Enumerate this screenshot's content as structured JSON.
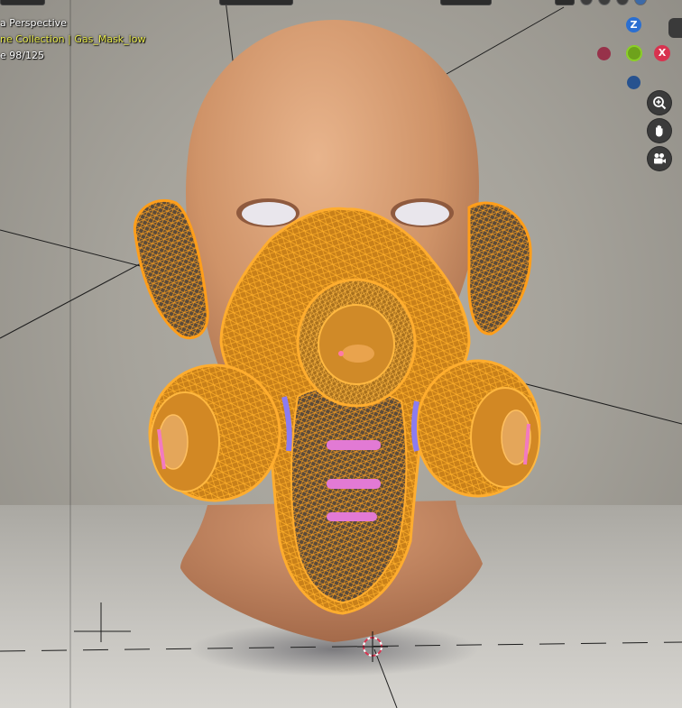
{
  "viewport": {
    "view_name": "a Perspective",
    "collection_path": "ne Collection | Gas_Mask_low",
    "frame_info": "e 98/125"
  },
  "navigation_gizmo": {
    "z_label": "Z",
    "y_label": "",
    "x_label": "X",
    "colors": {
      "x": "#d8334f",
      "y": "#6ea21c",
      "z": "#2b6fd1"
    }
  },
  "navigation_buttons": [
    {
      "name": "zoom",
      "icon": "zoom-in-icon"
    },
    {
      "name": "pan",
      "icon": "hand-icon"
    },
    {
      "name": "camera",
      "icon": "camera-icon"
    }
  ],
  "colors": {
    "wireframe": "#ff9e1a",
    "skin": "#cf9368",
    "selection_text": "#e6e84c"
  }
}
